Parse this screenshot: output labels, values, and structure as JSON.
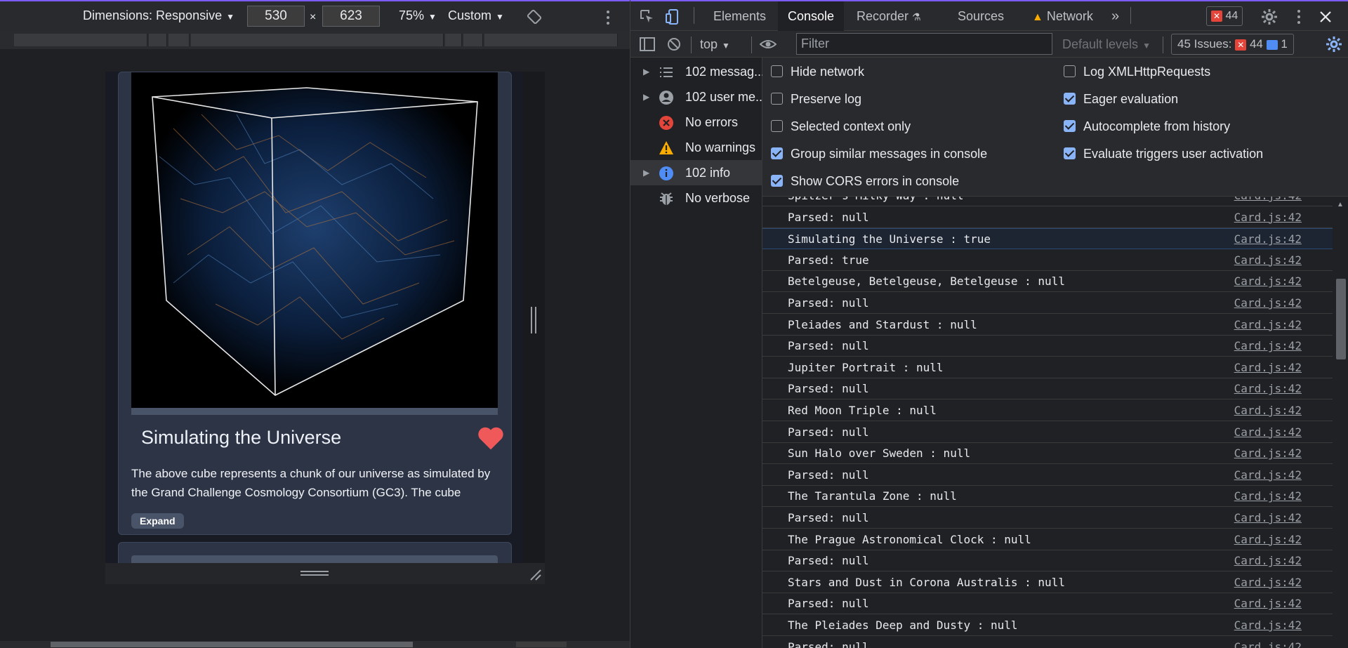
{
  "device_toolbar": {
    "dimensions_label": "Dimensions: Responsive",
    "width": "530",
    "times": "×",
    "height": "623",
    "zoom": "75%",
    "throttle": "Custom"
  },
  "card": {
    "title": "Simulating the Universe",
    "description": "The above cube represents a chunk of our universe as simulated by the Grand Challenge Cosmology Consortium (GC3). The cube",
    "expand_label": "Expand",
    "heart_color": "#f0595a"
  },
  "devtools": {
    "tabs": [
      "Elements",
      "Console",
      "Recorder",
      "Sources",
      "Network"
    ],
    "active_tab": "Console",
    "error_count": "44",
    "toolbar": {
      "context": "top",
      "filter_placeholder": "Filter",
      "levels": "Default levels",
      "issues_label": "45 Issues:",
      "issues_errors": "44",
      "issues_info": "1"
    },
    "sidebar": [
      {
        "label": "102 messag...",
        "icon": "list-icon",
        "expandable": true
      },
      {
        "label": "102 user me...",
        "icon": "user-icon",
        "expandable": true
      },
      {
        "label": "No errors",
        "icon": "error-icon",
        "expandable": false
      },
      {
        "label": "No warnings",
        "icon": "warning-icon",
        "expandable": false
      },
      {
        "label": "102 info",
        "icon": "info-icon",
        "expandable": true
      },
      {
        "label": "No verbose",
        "icon": "verbose-icon",
        "expandable": false
      }
    ],
    "settings_left": [
      {
        "label": "Hide network",
        "checked": false
      },
      {
        "label": "Preserve log",
        "checked": false
      },
      {
        "label": "Selected context only",
        "checked": false
      },
      {
        "label": "Group similar messages in console",
        "checked": true
      },
      {
        "label": "Show CORS errors in console",
        "checked": true
      }
    ],
    "settings_right": [
      {
        "label": "Log XMLHttpRequests",
        "checked": false
      },
      {
        "label": "Eager evaluation",
        "checked": true
      },
      {
        "label": "Autocomplete from history",
        "checked": true
      },
      {
        "label": "Evaluate triggers user activation",
        "checked": true
      }
    ],
    "log_source": "Card.js:42",
    "log": [
      "Spitzer's Milky Way : null",
      "Parsed: null",
      "Simulating the Universe : true",
      "Parsed: true",
      "Betelgeuse, Betelgeuse, Betelgeuse : null",
      "Parsed: null",
      "Pleiades and Stardust : null",
      "Parsed: null",
      "Jupiter Portrait : null",
      "Parsed: null",
      "Red Moon Triple : null",
      "Parsed: null",
      "Sun Halo over Sweden : null",
      "Parsed: null",
      "The Tarantula Zone : null",
      "Parsed: null",
      "The Prague Astronomical Clock : null",
      "Parsed: null",
      "Stars and Dust in Corona Australis : null",
      "Parsed: null",
      "The Pleiades Deep and Dusty : null",
      "Parsed: null"
    ],
    "highlighted_row": 2
  }
}
